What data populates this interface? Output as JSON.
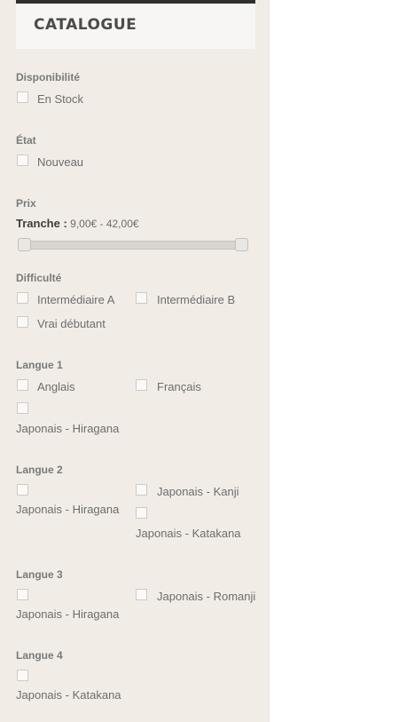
{
  "catalogue": {
    "title": "CATALOGUE"
  },
  "filters": {
    "disponibilite": {
      "title": "Disponibilité",
      "options": [
        "En Stock"
      ]
    },
    "etat": {
      "title": "État",
      "options": [
        "Nouveau"
      ]
    },
    "prix": {
      "title": "Prix",
      "range_prefix": "Tranche :",
      "range_value": "9,00€ - 42,00€",
      "range_min": 9.0,
      "range_max": 42.0
    },
    "difficulte": {
      "title": "Difficulté",
      "options": [
        "Intermédiaire A",
        "Intermédiaire B",
        "Vrai débutant"
      ]
    },
    "langue1": {
      "title": "Langue 1",
      "options": [
        "Anglais",
        "Français",
        "Japonais - Hiragana"
      ]
    },
    "langue2": {
      "title": "Langue 2",
      "options": [
        "Japonais - Hiragana",
        "Japonais - Kanji",
        "Japonais - Katakana"
      ]
    },
    "langue3": {
      "title": "Langue 3",
      "options": [
        "Japonais - Hiragana",
        "Japonais - Romanji"
      ]
    },
    "langue4": {
      "title": "Langue 4",
      "options": [
        "Japonais - Katakana"
      ]
    }
  }
}
